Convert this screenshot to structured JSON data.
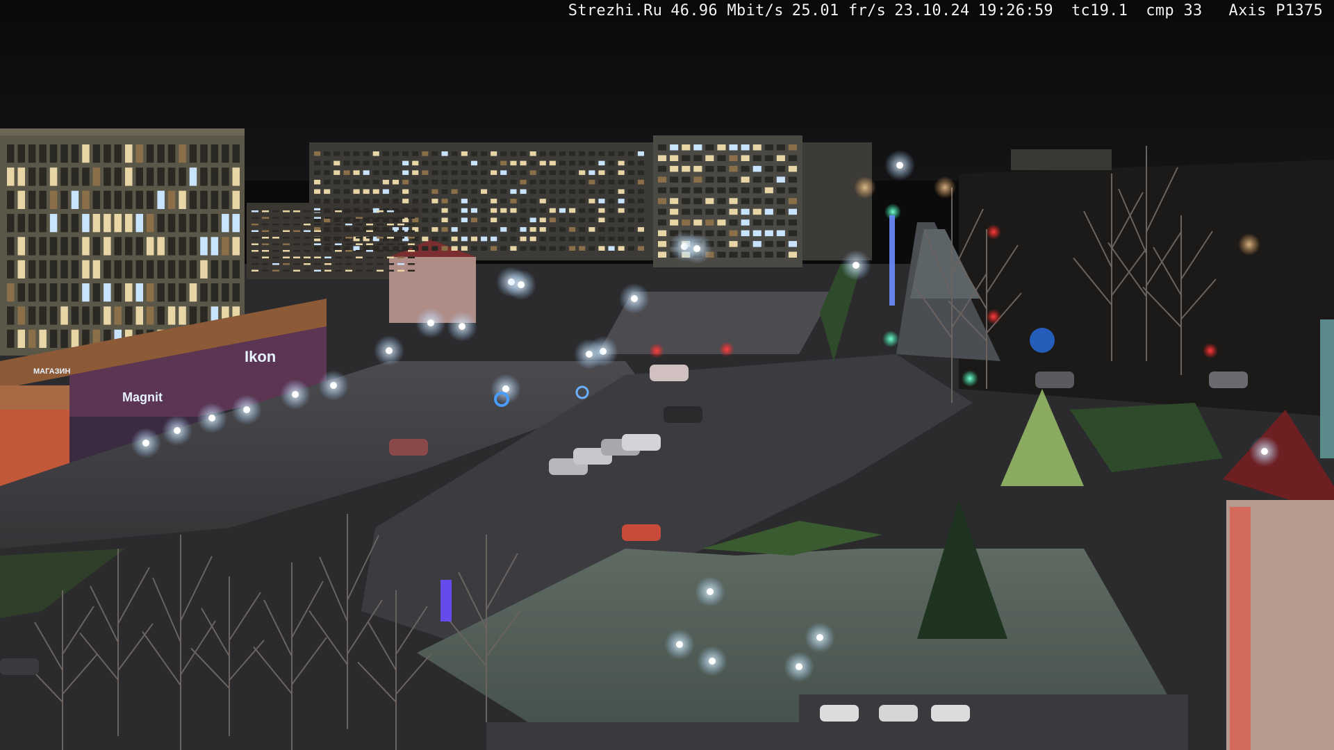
{
  "osd": {
    "site": "Strezhi.Ru",
    "bitrate": "46.96 Mbit/s",
    "framerate": "25.01 fr/s",
    "date": "23.10.24",
    "time": "19:26:59",
    "temperature": "tc19.1",
    "compression": "cmp 33",
    "camera_model": "Axis P1375"
  },
  "signs": {
    "store_main": "Ikon",
    "store_side": "Magnit",
    "store_sign_small": "МАГАЗИН"
  },
  "colors": {
    "sky": "#0b0b0c",
    "road": "#3c3c40",
    "grass": "#2f4a2a",
    "streetlight": "#e8f4ff",
    "signal_red": "#ff2a2a",
    "signal_green": "#2dffb0",
    "store_accent": "#d9482b"
  }
}
